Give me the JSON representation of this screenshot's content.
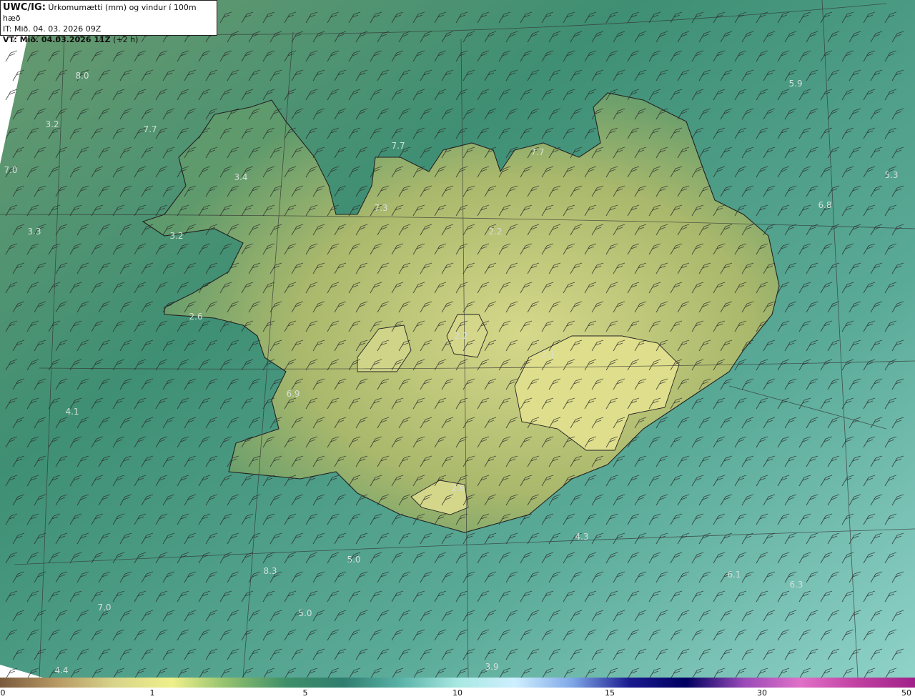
{
  "header": {
    "product": "UWC/IG:",
    "title": "Úrkomumætti (mm) og vindur í 100m hæð",
    "init_time": "IT: Mið. 04. 03. 2026 09Z",
    "valid_prefix": "VT: Mið. 04.03.2026 11Z",
    "valid_suffix": " (+2 h)"
  },
  "map_labels": [
    {
      "id": "l1",
      "text": "8.0"
    },
    {
      "id": "l2",
      "text": "3.2"
    },
    {
      "id": "l3",
      "text": "7.7"
    },
    {
      "id": "l4",
      "text": "7.0"
    },
    {
      "id": "l5",
      "text": "3.4"
    },
    {
      "id": "l6",
      "text": "3.3"
    },
    {
      "id": "l7",
      "text": "3.2"
    },
    {
      "id": "l8",
      "text": "7.7"
    },
    {
      "id": "l9",
      "text": "7.3"
    },
    {
      "id": "l10",
      "text": "7.7"
    },
    {
      "id": "l11",
      "text": "5.9"
    },
    {
      "id": "l12",
      "text": "5.3"
    },
    {
      "id": "l13",
      "text": "6.8"
    },
    {
      "id": "l14",
      "text": "2.2"
    },
    {
      "id": "l15",
      "text": "2.6"
    },
    {
      "id": "l16",
      "text": "2.2"
    },
    {
      "id": "l17",
      "text": "2.1"
    },
    {
      "id": "l18",
      "text": "6.9"
    },
    {
      "id": "l19",
      "text": "4.1"
    },
    {
      "id": "l20",
      "text": "2.6"
    },
    {
      "id": "l21",
      "text": "4.3"
    },
    {
      "id": "l22",
      "text": "5.0"
    },
    {
      "id": "l23",
      "text": "8.3"
    },
    {
      "id": "l24",
      "text": "6.1"
    },
    {
      "id": "l25",
      "text": "6.3"
    },
    {
      "id": "l26",
      "text": "7.0"
    },
    {
      "id": "l27",
      "text": "5.0"
    },
    {
      "id": "l28",
      "text": "4.4"
    },
    {
      "id": "l29",
      "text": "3.9"
    }
  ],
  "colorbar": {
    "ticks": [
      "0",
      "1",
      "5",
      "10",
      "15",
      "30",
      "50"
    ],
    "colors": [
      "#7a5a3c",
      "#b89a64",
      "#d8d48a",
      "#eef08a",
      "#8fbf6e",
      "#3e8f6a",
      "#2f7d6e",
      "#5ab3a8",
      "#a8e8e2",
      "#cfefff",
      "#7fa8e8",
      "#1a1a8f",
      "#000060",
      "#9a4ab8",
      "#e070c8",
      "#c040a0",
      "#a0208a"
    ]
  },
  "palette": {
    "sea": "#4e9c88",
    "land": "#b8c070",
    "contour": "#222222",
    "label": "#d8e2dc"
  }
}
